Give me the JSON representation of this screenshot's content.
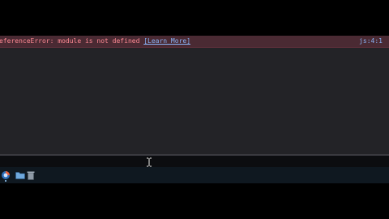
{
  "console": {
    "error": {
      "message": "eferenceError: module is not defined",
      "learn_more": "[Learn More]",
      "location": "js:4:1"
    }
  },
  "colors": {
    "panel_bg": "#232327",
    "error_bg": "#4a2a33",
    "error_text": "#ff8a94",
    "link": "#8ab4f8",
    "taskbar_bg": "#0f1820"
  },
  "taskbar": {
    "apps": [
      {
        "icon": "browser-icon",
        "active": true
      },
      {
        "icon": "folder-icon",
        "active": false
      },
      {
        "icon": "trash-icon",
        "active": false
      }
    ]
  },
  "cursor": {
    "icon": "text-cursor-icon"
  }
}
